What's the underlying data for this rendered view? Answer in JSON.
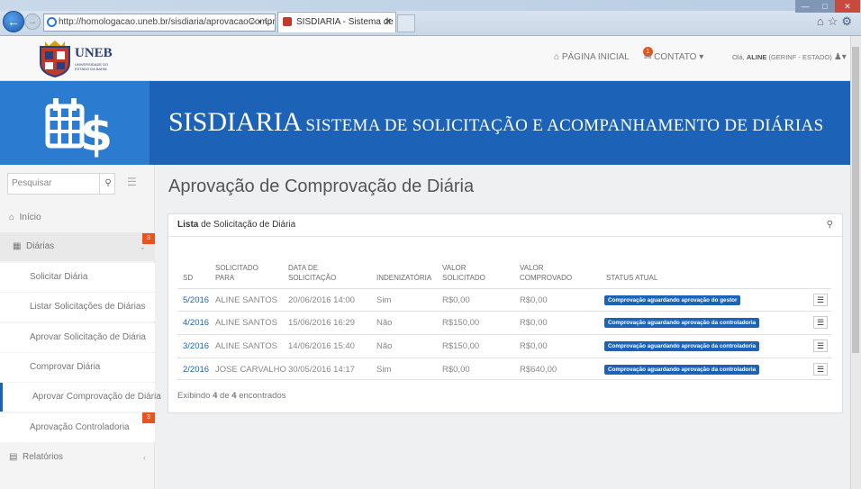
{
  "browser": {
    "address": "http://homologacao.uneb.br/sisdiaria/aprovacaoComprov",
    "tab_title": "SISDIARIA - Sistema de Soli...",
    "tab_close": "✕"
  },
  "header": {
    "logo_text": "UNEB",
    "logo_sub": "UNIVERSIDADE DO ESTADO DA BAHIA",
    "home_label": "PÁGINA INICIAL",
    "contact_label": "CONTATO",
    "contact_badge": "1",
    "user_greeting": "Olá,",
    "user_name": "ALINE",
    "user_role": "(GERINF - ESTADO)"
  },
  "banner": {
    "title": "SISDIARIA",
    "subtitle": "SISTEMA DE SOLICITAÇÃO E ACOMPANHAMENTO DE DIÁRIAS"
  },
  "sidebar": {
    "search_placeholder": "Pesquisar",
    "items": [
      {
        "label": "Início"
      },
      {
        "label": "Diárias",
        "badge": "3"
      },
      {
        "label": "Solicitar Diária"
      },
      {
        "label": "Listar Solicitações de Diárias"
      },
      {
        "label": "Aprovar Solicitação de Diária"
      },
      {
        "label": "Comprovar Diária"
      },
      {
        "label": "Aprovar Comprovação de Diária"
      },
      {
        "label": "Aprovação Controladoria",
        "badge": "3"
      },
      {
        "label": "Relatórios"
      }
    ]
  },
  "main": {
    "page_title": "Aprovação de Comprovação de Diária",
    "panel_title_bold": "Lista",
    "panel_title_rest": "de Solicitação de Diária",
    "columns": [
      "SD",
      "SOLICITADO PARA",
      "DATA DE SOLICITAÇÃO",
      "INDENIZATÓRIA",
      "VALOR SOLICITADO",
      "VALOR COMPROVADO",
      "STATUS ATUAL"
    ],
    "rows": [
      {
        "sd": "5/2016",
        "para": "ALINE SANTOS",
        "data": "20/06/2016 14:00",
        "indenizatoria": "Sim",
        "solicitado": "R$0,00",
        "comprovado": "R$0,00",
        "status": "Comprovação aguardando aprovação do gestor"
      },
      {
        "sd": "4/2016",
        "para": "ALINE SANTOS",
        "data": "15/06/2016 16:29",
        "indenizatoria": "Não",
        "solicitado": "R$150,00",
        "comprovado": "R$0,00",
        "status": "Comprovação aguardando aprovação da controladoria"
      },
      {
        "sd": "3/2016",
        "para": "ALINE SANTOS",
        "data": "14/06/2016 15:40",
        "indenizatoria": "Não",
        "solicitado": "R$150,00",
        "comprovado": "R$0,00",
        "status": "Comprovação aguardando aprovação da controladoria"
      },
      {
        "sd": "2/2016",
        "para": "JOSE CARVALHO",
        "data": "30/05/2016 14:17",
        "indenizatoria": "Sim",
        "solicitado": "R$0,00",
        "comprovado": "R$640,00",
        "status": "Comprovação aguardando aprovação da controladoria"
      }
    ],
    "footer_prefix": "Exibindo",
    "footer_shown": "4",
    "footer_mid": "de",
    "footer_total": "4",
    "footer_suffix": "encontrados"
  },
  "colors": {
    "primary": "#1c63b7",
    "badge": "#e8541a"
  }
}
